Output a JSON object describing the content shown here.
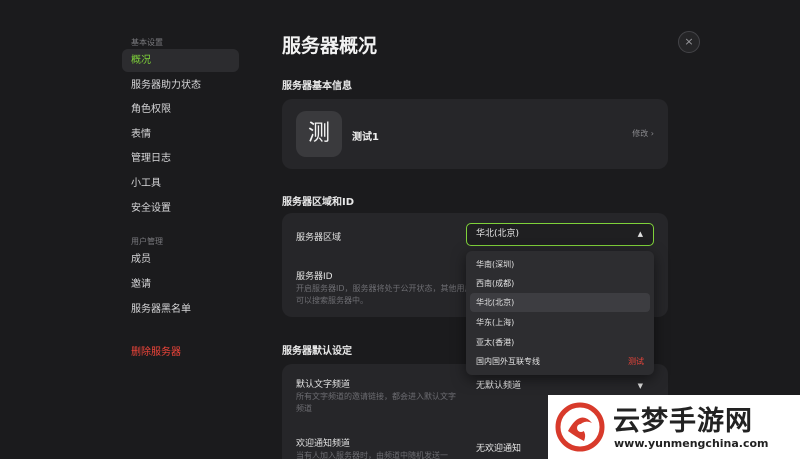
{
  "sidebar": {
    "section_basic": "基本设置",
    "section_user": "用户管理",
    "items": [
      {
        "label": "概况"
      },
      {
        "label": "服务器助力状态"
      },
      {
        "label": "角色权限"
      },
      {
        "label": "表情"
      },
      {
        "label": "管理日志"
      },
      {
        "label": "小工具"
      },
      {
        "label": "安全设置"
      },
      {
        "label": "成员"
      },
      {
        "label": "邀请"
      },
      {
        "label": "服务器黑名单"
      }
    ],
    "delete_label": "删除服务器"
  },
  "main": {
    "title": "服务器概况",
    "close_icon": "×",
    "basic_info": {
      "heading": "服务器基本信息",
      "avatar_char": "测",
      "server_name": "测试1",
      "edit_label": "修改 ›"
    },
    "region": {
      "heading": "服务器区域和ID",
      "region_label": "服务器区域",
      "region_value": "华北(北京)",
      "id_label": "服务器ID",
      "id_desc": "开启服务器ID，服务器将处于公开状态，其他用户可以搜索服务器中。"
    },
    "dropdown": {
      "options": [
        {
          "label": "华南(深圳)"
        },
        {
          "label": "西南(成都)"
        },
        {
          "label": "华北(北京)"
        },
        {
          "label": "华东(上海)"
        },
        {
          "label": "亚太(香港)"
        },
        {
          "label": "国内国外互联专线",
          "tag": "测试"
        }
      ],
      "selected": "华北(北京)"
    },
    "defaults": {
      "heading": "服务器默认设定",
      "text_channel_label": "默认文字频道",
      "text_channel_desc": "所有文字频道的邀请链接，都会进入默认文字频道",
      "text_channel_value": "无默认频道",
      "welcome_label": "欢迎通知频道",
      "welcome_desc": "当有人加入服务器时，由频道中随机发送一",
      "welcome_value": "无欢迎通知"
    }
  },
  "watermark": {
    "title": "云梦手游网",
    "url": "www.yunmengchina.com"
  },
  "colors": {
    "accent": "#7fd23a",
    "danger": "#f0453a",
    "background": "#1b1b1d",
    "card": "#262629"
  }
}
